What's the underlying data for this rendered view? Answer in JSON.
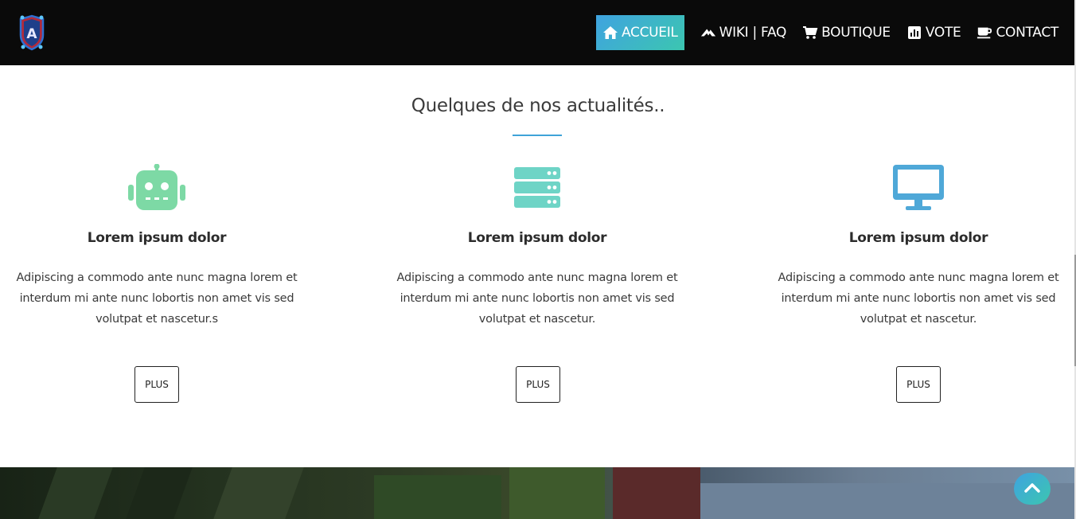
{
  "nav": {
    "items": [
      {
        "label": "ACCUEIL",
        "icon": "home-icon",
        "active": true
      },
      {
        "label": "WIKI | FAQ",
        "icon": "wiki-icon",
        "active": false
      },
      {
        "label": "BOUTIQUE",
        "icon": "cart-icon",
        "active": false
      },
      {
        "label": "VOTE",
        "icon": "bar-chart-icon",
        "active": false
      },
      {
        "label": "CONTACT",
        "icon": "coffee-icon",
        "active": false
      }
    ]
  },
  "section": {
    "title": "Quelques de nos actualités.."
  },
  "cards": [
    {
      "icon": "robot-icon",
      "icon_color": "#7dd9a5",
      "title": "Lorem ipsum dolor",
      "text": "Adipiscing a commodo ante nunc magna lorem et interdum mi ante nunc lobortis non amet vis sed volutpat et nascetur.s",
      "button": "PLUS"
    },
    {
      "icon": "server-icon",
      "icon_color": "#6ed4c6",
      "title": "Lorem ipsum dolor",
      "text": "Adipiscing a commodo ante nunc magna lorem et interdum mi ante nunc lobortis non amet vis sed volutpat et nascetur.",
      "button": "PLUS"
    },
    {
      "icon": "desktop-icon",
      "icon_color": "#4fa8d8",
      "title": "Lorem ipsum dolor",
      "text": "Adipiscing a commodo ante nunc magna lorem et interdum mi ante nunc lobortis non amet vis sed volutpat et nascetur.",
      "button": "PLUS"
    }
  ],
  "back_to_top": {
    "icon": "chevron-up-icon"
  }
}
